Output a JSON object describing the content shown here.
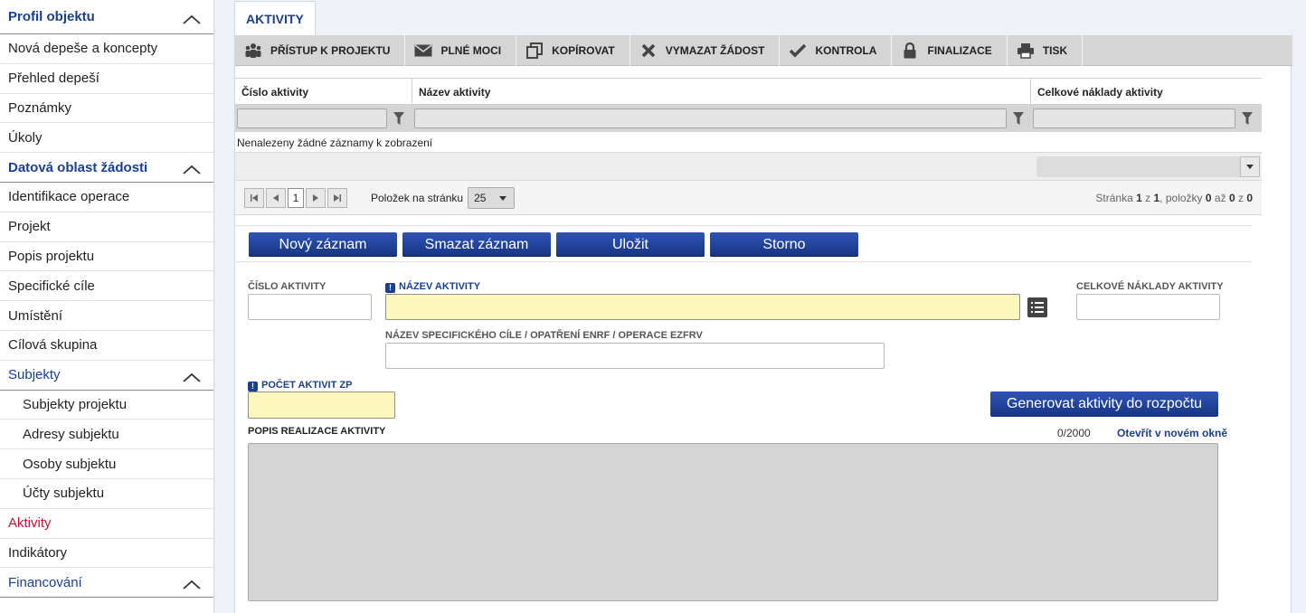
{
  "sidebar": {
    "items": [
      {
        "label": "Profil objektu",
        "kind": "section",
        "collapsible": true
      },
      {
        "label": "Nová depeše a koncepty",
        "kind": "item"
      },
      {
        "label": "Přehled depeší",
        "kind": "item"
      },
      {
        "label": "Poznámky",
        "kind": "item"
      },
      {
        "label": "Úkoly",
        "kind": "item"
      },
      {
        "label": "Datová oblast žádosti",
        "kind": "section",
        "collapsible": true
      },
      {
        "label": "Identifikace operace",
        "kind": "item"
      },
      {
        "label": "Projekt",
        "kind": "item"
      },
      {
        "label": "Popis projektu",
        "kind": "item"
      },
      {
        "label": "Specifické cíle",
        "kind": "item"
      },
      {
        "label": "Umístění",
        "kind": "item"
      },
      {
        "label": "Cílová skupina",
        "kind": "item"
      },
      {
        "label": "Subjekty",
        "kind": "section-plain",
        "collapsible": true
      },
      {
        "label": "Subjekty projektu",
        "kind": "sub"
      },
      {
        "label": "Adresy subjektu",
        "kind": "sub"
      },
      {
        "label": "Osoby subjektu",
        "kind": "sub"
      },
      {
        "label": "Účty subjektu",
        "kind": "sub"
      },
      {
        "label": "Aktivity",
        "kind": "active"
      },
      {
        "label": "Indikátory",
        "kind": "item"
      },
      {
        "label": "Financování",
        "kind": "section-plain",
        "collapsible": true
      }
    ]
  },
  "tab": {
    "label": "AKTIVITY"
  },
  "toolbar": {
    "buttons": [
      {
        "label": "PŘÍSTUP K PROJEKTU",
        "icon": "users-icon"
      },
      {
        "label": "PLNÉ MOCI",
        "icon": "envelope-icon"
      },
      {
        "label": "KOPÍROVAT",
        "icon": "copy-icon"
      },
      {
        "label": "VYMAZAT ŽÁDOST",
        "icon": "cross-icon"
      },
      {
        "label": "KONTROLA",
        "icon": "check-icon"
      },
      {
        "label": "FINALIZACE",
        "icon": "lock-icon"
      },
      {
        "label": "TISK",
        "icon": "printer-icon"
      }
    ]
  },
  "grid": {
    "columns": [
      "Číslo aktivity",
      "Název aktivity",
      "Celkové náklady aktivity"
    ],
    "empty_message": "Nenalezeny žádné záznamy k zobrazení",
    "pager": {
      "current_page": "1",
      "page_size_label": "Položek na stránku",
      "page_size": "25",
      "info_prefix": "Stránka",
      "page": "1",
      "of_word": "z",
      "pages": "1",
      "items_word": ", položky",
      "from": "0",
      "to_word": "až",
      "to": "0",
      "total_word": "z",
      "total": "0"
    }
  },
  "form": {
    "buttons": {
      "new": "Nový záznam",
      "delete": "Smazat záznam",
      "save": "Uložit",
      "cancel": "Storno"
    },
    "labels": {
      "cislo": "ČÍSLO AKTIVITY",
      "nazev": "NÁZEV AKTIVITY",
      "naklady": "CELKOVÉ NÁKLADY AKTIVITY",
      "specificky_cil": "NÁZEV SPECIFICKÉHO CÍLE / OPATŘENÍ ENRF / OPERACE EZFRV",
      "pocet": "POČET AKTIVIT ZP",
      "popis": "POPIS REALIZACE AKTIVITY"
    },
    "values": {
      "cislo": "",
      "nazev": "",
      "naklady": "",
      "specificky_cil": "",
      "pocet": "",
      "popis": ""
    },
    "generate_button": "Generovat aktivity do rozpočtu",
    "counter": "0/2000",
    "open_new_window": "Otevřít v novém okně"
  }
}
